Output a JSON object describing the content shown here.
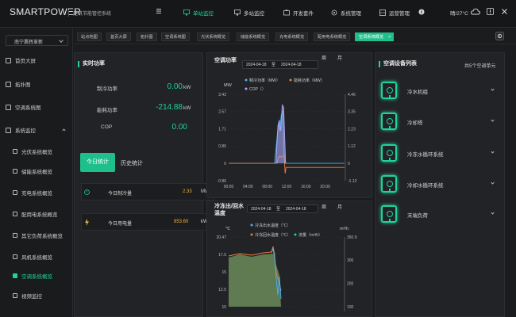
{
  "header": {
    "logo_text": "SMARTPOWER",
    "system_name": "建筑节能管控系统",
    "nav": [
      {
        "label": "单站监控",
        "active": true
      },
      {
        "label": "多站监控",
        "active": false
      },
      {
        "label": "开发套件",
        "active": false
      },
      {
        "label": "系统管理",
        "active": false
      },
      {
        "label": "运营管理",
        "active": false
      }
    ],
    "weather": "晴/27°C"
  },
  "sidebar": {
    "org_select": "南宁裹辉革新",
    "items": [
      {
        "label": "首页大屏"
      },
      {
        "label": "拓扑图"
      },
      {
        "label": "空调系统图"
      },
      {
        "label": "系统监控"
      },
      {
        "label": "光伏系统概览"
      },
      {
        "label": "储能系统概览"
      },
      {
        "label": "充电系统概览"
      },
      {
        "label": "配用电系统概览"
      },
      {
        "label": "其它负荷系统概览"
      },
      {
        "label": "风机系统概览"
      },
      {
        "label": "空调系统概览"
      },
      {
        "label": "视频监控"
      }
    ]
  },
  "tabs": [
    "站点地图",
    "首页大屏",
    "拓扑图",
    "空调系统图",
    "光伏系统概览",
    "储能系统概览",
    "充电系统概览",
    "配用电系统概览",
    "空调系统概览"
  ],
  "realtime": {
    "title": "实时功率",
    "rows": [
      {
        "label": "制冷功率",
        "value": "0.00",
        "unit": "kW"
      },
      {
        "label": "能耗功率",
        "value": "-214.88",
        "unit": "kW"
      },
      {
        "label": "COP",
        "value": "0.00",
        "unit": ""
      }
    ],
    "tab_today": "今日统计",
    "tab_history": "历史统计",
    "stats": [
      {
        "label": "今日制冷量",
        "value": "2.33",
        "unit": "MWh"
      },
      {
        "label": "今日用电量",
        "value": "853.60",
        "unit": "kWh"
      }
    ]
  },
  "ac_power": {
    "title": "空调功率",
    "date_start": "2024-04-18",
    "date_sep": "至",
    "date_end": "2024-04-18",
    "period_week": "周",
    "period_month": "月",
    "left_unit": "MW",
    "right_unit": "",
    "legend": [
      "制冷功率（MW）",
      "能耗功率（MW）",
      "COP（）"
    ]
  },
  "ac_temp": {
    "title": "冷冻出/回水温度",
    "date_start": "2024-04-18",
    "date_sep": "至",
    "date_end": "2024-04-18",
    "period_week": "周",
    "period_month": "月",
    "left_unit": "℃",
    "right_unit": "m³/h",
    "legend": [
      "冷冻出水温度（℃）",
      "冷冻回水温度（℃）",
      "流量（m³/h）"
    ]
  },
  "chart_data": [
    {
      "type": "line",
      "title": "空调功率",
      "x_ticks": [
        "00:00",
        "04:00",
        "08:00",
        "12:00",
        "16:00",
        "20:00"
      ],
      "y_left_ticks": [
        "3.42",
        "2.57",
        "1.71",
        "0.86",
        "0",
        "-0.86"
      ],
      "y_right_ticks": [
        "4.46",
        "3.35",
        "2.23",
        "1.12",
        "0",
        "-1.12"
      ],
      "ylim_left": [
        -0.86,
        3.42
      ],
      "ylim_right": [
        -1.12,
        4.46
      ],
      "series": [
        {
          "name": "制冷功率（MW）",
          "color": "#3fb4ff",
          "x": [
            0,
            9.5,
            10.0,
            10.3,
            10.6,
            10.9,
            11.2,
            11.5,
            11.8,
            24
          ],
          "y": [
            0,
            0,
            1.2,
            2.0,
            1.6,
            2.4,
            2.6,
            0.2,
            0,
            0
          ]
        },
        {
          "name": "能耗功率（MW）",
          "color": "#f07d3a",
          "x": [
            0,
            10.0,
            10.3,
            10.6,
            10.9,
            11.2,
            11.5,
            11.7,
            11.9,
            24
          ],
          "y": [
            0,
            0,
            0.3,
            0.35,
            0.3,
            0.35,
            0.4,
            -0.5,
            -0.2,
            -0.2
          ]
        },
        {
          "name": "COP（）",
          "color": "#a9a9f5",
          "x": [
            9.8,
            10.2,
            10.5,
            10.8,
            11.1,
            11.4,
            11.8
          ],
          "y": [
            0,
            2.4,
            2.8,
            2.1,
            3.8,
            3.6,
            0
          ],
          "axis": "right"
        }
      ]
    },
    {
      "type": "area",
      "title": "冷冻出/回水温度",
      "y_left_ticks": [
        "20.47",
        "17.5",
        "15",
        "12.5",
        "10"
      ],
      "y_right_ticks": [
        "350.9",
        "300",
        "200",
        "100"
      ],
      "series": [
        {
          "name": "冷冻出水温度（℃）",
          "color": "#3fb4ff"
        },
        {
          "name": "冷冻回水温度（℃）",
          "color": "#f07d3a"
        },
        {
          "name": "流量（m³/h）",
          "color": "#1fd39b"
        }
      ]
    }
  ],
  "devices": {
    "title": "空调设备列表",
    "count_text": "共5个空调单元",
    "items": [
      {
        "name": "冷水机组"
      },
      {
        "name": "冷却塔"
      },
      {
        "name": "冷冻水循环系统"
      },
      {
        "name": "冷却水循环系统"
      },
      {
        "name": "末端负荷"
      }
    ]
  }
}
